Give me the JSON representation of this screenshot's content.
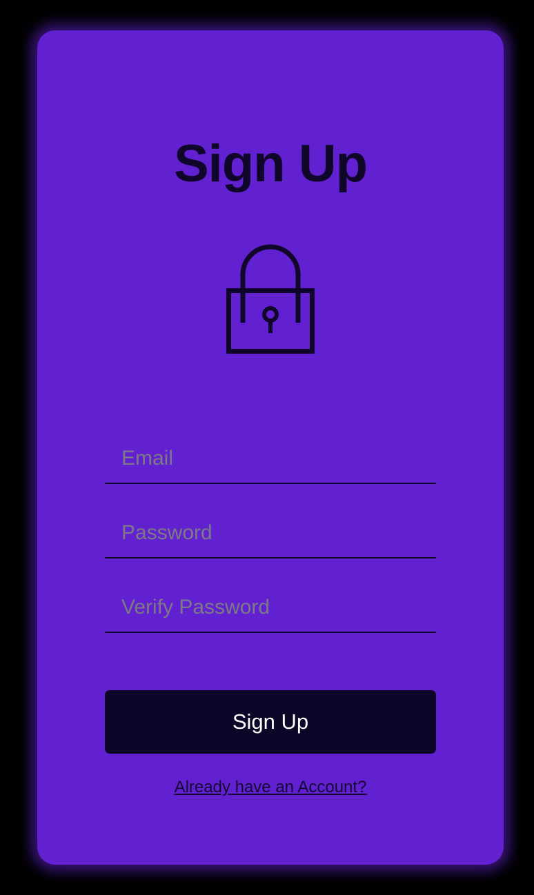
{
  "page": {
    "title": "Sign Up",
    "icon": "lock-icon"
  },
  "form": {
    "email_placeholder": "Email",
    "password_placeholder": "Password",
    "verify_password_placeholder": "Verify Password",
    "submit_label": "Sign Up"
  },
  "footer": {
    "login_link": "Already have an Account?"
  },
  "colors": {
    "background": "#000000",
    "card": "#6221d1",
    "text_dark": "#0f0629",
    "button": "#0d0628",
    "button_text": "#ffffff",
    "placeholder": "#7d7a86"
  }
}
